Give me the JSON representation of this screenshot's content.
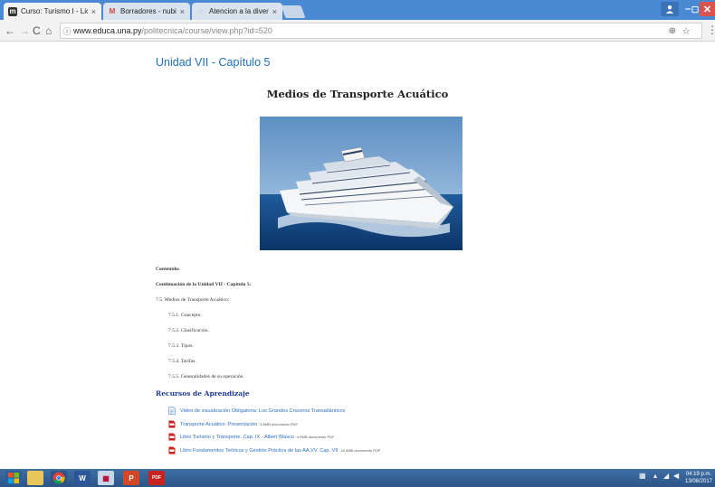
{
  "browser": {
    "tabs": [
      {
        "label": "Curso: Turismo I - Lic. en",
        "favicon": "moodle-icon",
        "active": true
      },
      {
        "label": "Borradores - nubia@po",
        "favicon": "gmail-icon",
        "active": false
      },
      {
        "label": "Atencion a la diversidad",
        "favicon": "loading-icon",
        "active": false
      }
    ],
    "url_host": "www.educa.una.py",
    "url_path": "/politecnica/course/view.php?id=520"
  },
  "page": {
    "chapter_heading": "Unidad VII - Capítulo 5",
    "title": "Medios de Transporte Acuático",
    "contents": {
      "heading": "Contenido:",
      "subheading": "Continuación de la Unidad VII - Capítulo 5:",
      "main_item": "7.5.  Medios de Transporte Acuático:",
      "subitems": [
        "7.5.1.  Concepto.",
        "7.5.2.  Clasificación.",
        "7.5.3.  Tipos.",
        "7.5.4.  Tarifas.",
        "7.5.5.  Generalidades de su operación."
      ]
    },
    "resources": {
      "heading": "Recursos de Aprendizaje",
      "items": [
        {
          "label": "Video de visualización Obligatoria: Los Grandes Cruceros Transatlánticos",
          "meta": "",
          "icon": "page-icon"
        },
        {
          "label": "Transporte Acuático: Presentación",
          "meta": "5.5MB documento PDF",
          "icon": "pdf-icon"
        },
        {
          "label": "Libro Turismo y Transporte. Cap. IX - Albert Blasco",
          "meta": "4.9MB documento PDF",
          "icon": "pdf-icon"
        },
        {
          "label": "Libro Fundamentos Teóricos y Gestión Práctica de las AA.VV. Cap. VII",
          "meta": "16.4MB documento PDF",
          "icon": "pdf-icon"
        }
      ]
    }
  },
  "taskbar": {
    "apps": [
      "file-explorer-icon",
      "chrome-icon",
      "word-icon",
      "paint-icon",
      "powerpoint-icon",
      "pdf-reader-icon"
    ],
    "time": "04:19 p.m.",
    "date": "13/08/2017"
  }
}
